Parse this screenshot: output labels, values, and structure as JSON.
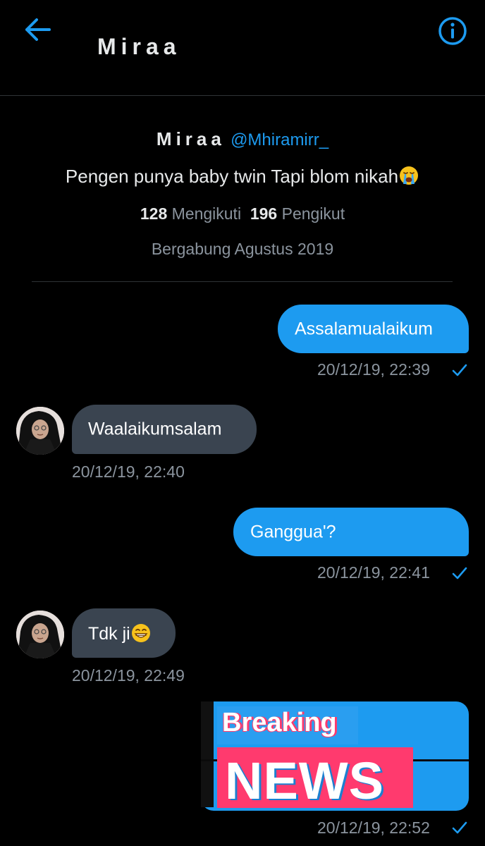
{
  "header": {
    "title": "Miraa",
    "back_icon": "arrow-left-icon",
    "info_icon": "info-circle-icon"
  },
  "profile": {
    "name": "Miraa",
    "handle": "@Mhiramirr_",
    "bio": "Pengen punya baby twin Tapi blom nikah",
    "bio_emoji": "loudly-crying-face-emoji",
    "following_count": "128",
    "following_label": "Mengikuti",
    "followers_count": "196",
    "followers_label": "Pengikut",
    "joined": "Bergabung Agustus 2019"
  },
  "messages": [
    {
      "direction": "out",
      "text": "Assalamualaikum",
      "timestamp": "20/12/19, 22:39",
      "status_icon": "check-icon"
    },
    {
      "direction": "in",
      "text": "Waalaikumsalam",
      "timestamp": "20/12/19, 22:40"
    },
    {
      "direction": "out",
      "text": "Ganggua'?",
      "timestamp": "20/12/19, 22:41",
      "status_icon": "check-icon"
    },
    {
      "direction": "in",
      "text": "Tdk ji",
      "emoji": "grinning-face-emoji",
      "timestamp": "20/12/19, 22:49"
    },
    {
      "direction": "out",
      "media": {
        "line1": "Breaking",
        "line2": "NEWS"
      },
      "timestamp": "20/12/19, 22:52",
      "status_icon": "check-icon"
    }
  ],
  "colors": {
    "background": "#000000",
    "accent": "#1d9bf0",
    "incoming_bubble": "#3a4450",
    "muted_text": "#8b949e",
    "news_pink": "#ff3a6e"
  }
}
